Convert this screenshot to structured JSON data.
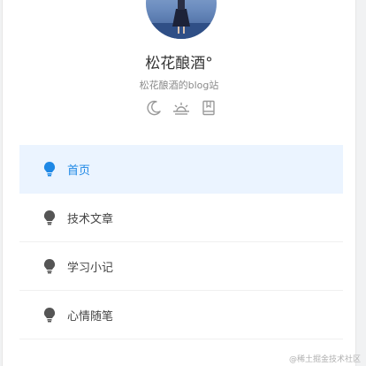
{
  "profile": {
    "name": "松花酿酒°",
    "subtitle": "松花酿酒的blog站"
  },
  "quick_icons": [
    "moon-icon",
    "sunrise-icon",
    "book-icon"
  ],
  "menu": {
    "items": [
      {
        "label": "首页",
        "icon": "lightbulb-icon",
        "active": true
      },
      {
        "label": "技术文章",
        "icon": "lightbulb-icon",
        "active": false
      },
      {
        "label": "学习小记",
        "icon": "lightbulb-icon",
        "active": false
      },
      {
        "label": "心情随笔",
        "icon": "lightbulb-icon",
        "active": false
      }
    ]
  },
  "watermark": "@稀土掘金技术社区",
  "colors": {
    "active_bg": "#ebf4ff",
    "active_text": "#1e88e5",
    "icon_gray": "#555555"
  }
}
